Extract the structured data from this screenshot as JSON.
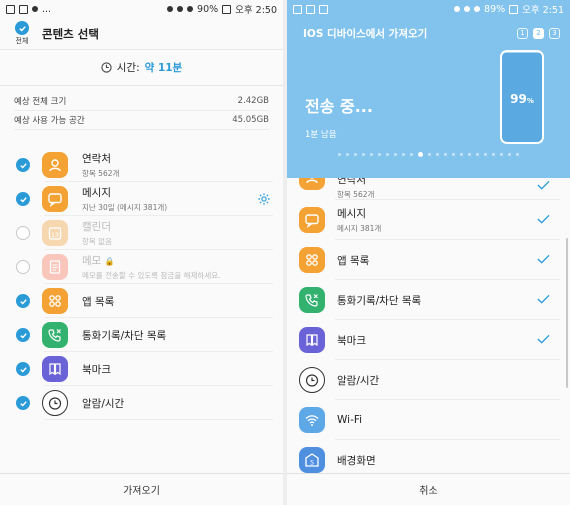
{
  "left": {
    "status": {
      "battery": "90%",
      "time": "오후 2:50",
      "dots": "..."
    },
    "select_all_label": "전체",
    "title": "콘텐츠 선택",
    "time_label": "시간:",
    "time_value": "약 11분",
    "storage": [
      {
        "label": "예상 전체 크기",
        "value": "2.42GB"
      },
      {
        "label": "예상 사용 가능 공간",
        "value": "45.05GB"
      }
    ],
    "items": [
      {
        "name": "연락처",
        "sub": "항목 562개",
        "checked": true,
        "icon": "contacts-icon",
        "color": "#f4a233"
      },
      {
        "name": "메시지",
        "sub": "지난 30일 (메시지 381개)",
        "checked": true,
        "icon": "message-icon",
        "color": "#f4a233"
      },
      {
        "name": "캘린더",
        "sub": "항목 없음",
        "checked": false,
        "icon": "calendar-icon",
        "color": "#f7d7b0"
      },
      {
        "name": "메모",
        "sub": "메모를 전송할 수 있도록 잠금을 해제하세요.",
        "checked": false,
        "icon": "memo-icon",
        "color": "#f9c6bb"
      },
      {
        "name": "앱 목록",
        "sub": "",
        "checked": true,
        "icon": "apps-icon",
        "color": "#f4a233"
      },
      {
        "name": "통화기록/차단 목록",
        "sub": "",
        "checked": true,
        "icon": "call-log-icon",
        "color": "#33b26f"
      },
      {
        "name": "북마크",
        "sub": "",
        "checked": true,
        "icon": "bookmark-icon",
        "color": "#6a63d8"
      },
      {
        "name": "알람/시간",
        "sub": "",
        "checked": true,
        "icon": "alarm-icon",
        "color": "#ffffff"
      }
    ],
    "bottom_button": "가져오기"
  },
  "right": {
    "status": {
      "battery": "89%",
      "time": "오후 2:51"
    },
    "title": "IOS 디바이스에서 가져오기",
    "steps": [
      "1",
      "2",
      "3"
    ],
    "active_step": "2",
    "sending": "전송 중...",
    "remaining": "1분 남음",
    "progress_pct": "99",
    "progress_unit": "%",
    "items": [
      {
        "name": "연락처",
        "sub": "항목 562개",
        "done": true,
        "icon": "contacts-icon",
        "color": "#f4a233",
        "partial": true
      },
      {
        "name": "메시지",
        "sub": "메시지 381개",
        "done": true,
        "icon": "message-icon",
        "color": "#f4a233"
      },
      {
        "name": "앱 목록",
        "sub": "",
        "done": true,
        "icon": "apps-icon",
        "color": "#f4a233"
      },
      {
        "name": "통화기록/차단 목록",
        "sub": "",
        "done": true,
        "icon": "call-log-icon",
        "color": "#33b26f"
      },
      {
        "name": "북마크",
        "sub": "",
        "done": true,
        "icon": "bookmark-icon",
        "color": "#6a63d8"
      },
      {
        "name": "알람/시간",
        "sub": "",
        "done": false,
        "icon": "alarm-icon",
        "color": "#ffffff"
      },
      {
        "name": "Wi-Fi",
        "sub": "",
        "done": false,
        "icon": "wifi-icon",
        "color": "#5fa8e8"
      },
      {
        "name": "배경화면",
        "sub": "",
        "done": false,
        "icon": "wallpaper-icon",
        "color": "#4f8fe0"
      }
    ],
    "bottom_button": "취소"
  },
  "colors": {
    "accent": "#2b9bd8",
    "header_blue": "#82c3ee"
  }
}
